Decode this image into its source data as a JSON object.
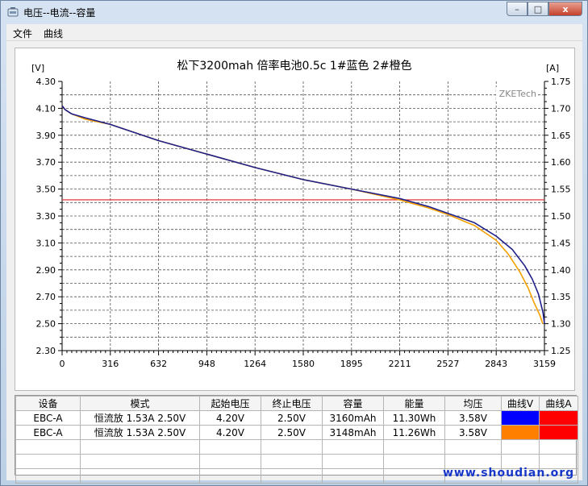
{
  "window": {
    "title": "电压--电流--容量",
    "icon": "battery-app-icon",
    "controls": {
      "minimize": "–",
      "maximize": "□",
      "close": "x"
    }
  },
  "menu": [
    {
      "label": "文件"
    },
    {
      "label": "曲线"
    }
  ],
  "colors": {
    "series1": "#1f1f8a",
    "series2": "#f5a000",
    "refline": "#e02020",
    "swatch_blue": "#0000ff",
    "swatch_orange": "#ff8000",
    "swatch_red": "#ff0000"
  },
  "chart_data": {
    "type": "line",
    "title": "松下3200mah 倍率电池0.5c 1#蓝色 2#橙色",
    "watermark": "ZKETech",
    "y_left_unit": "[V]",
    "y_right_unit": "[A]",
    "xlim": [
      0,
      3159
    ],
    "ylim": [
      2.3,
      4.3
    ],
    "y2lim": [
      1.25,
      1.75
    ],
    "x_ticks": [
      "0",
      "316",
      "632",
      "948",
      "1264",
      "1580",
      "1895",
      "2211",
      "2527",
      "2843",
      "3159"
    ],
    "y_ticks": [
      "2.30",
      "2.50",
      "2.70",
      "2.90",
      "3.10",
      "3.30",
      "3.50",
      "3.70",
      "3.90",
      "4.10",
      "4.30"
    ],
    "y2_ticks": [
      "1.25",
      "1.30",
      "1.35",
      "1.40",
      "1.45",
      "1.50",
      "1.55",
      "1.60",
      "1.65",
      "1.70",
      "1.75"
    ],
    "grid": true,
    "reference_line_y2": 1.53,
    "series": [
      {
        "x": [
          0,
          20,
          60,
          150,
          316,
          632,
          948,
          1264,
          1580,
          1895,
          2211,
          2400,
          2527,
          2700,
          2843,
          2950,
          3030,
          3080,
          3120,
          3150,
          3159
        ],
        "y": [
          4.12,
          4.09,
          4.06,
          4.03,
          3.98,
          3.86,
          3.76,
          3.66,
          3.57,
          3.5,
          3.43,
          3.37,
          3.32,
          3.25,
          3.15,
          3.05,
          2.93,
          2.83,
          2.72,
          2.58,
          2.5
        ]
      },
      {
        "x": [
          0,
          20,
          60,
          150,
          316,
          632,
          948,
          1264,
          1580,
          1895,
          2211,
          2400,
          2527,
          2700,
          2843,
          2920,
          3000,
          3050,
          3090,
          3130,
          3148
        ],
        "y": [
          4.12,
          4.09,
          4.06,
          4.02,
          3.98,
          3.86,
          3.76,
          3.66,
          3.57,
          3.5,
          3.42,
          3.36,
          3.31,
          3.23,
          3.12,
          3.02,
          2.88,
          2.77,
          2.66,
          2.56,
          2.5
        ]
      }
    ]
  },
  "table": {
    "headers": [
      "设备",
      "模式",
      "起始电压",
      "终止电压",
      "容量",
      "能量",
      "均压",
      "曲线V",
      "曲线A"
    ],
    "rows": [
      {
        "device": "EBC-A",
        "mode": "恒流放  1.53A  2.50V",
        "start_v": "4.20V",
        "end_v": "2.50V",
        "capacity": "3160mAh",
        "energy": "11.30Wh",
        "avg_v": "3.58V",
        "curve_v_color": "#0000ff",
        "curve_a_color": "#ff0000"
      },
      {
        "device": "EBC-A",
        "mode": "恒流放  1.53A  2.50V",
        "start_v": "4.20V",
        "end_v": "2.50V",
        "capacity": "3148mAh",
        "energy": "11.26Wh",
        "avg_v": "3.58V",
        "curve_v_color": "#ff8000",
        "curve_a_color": "#ff0000"
      }
    ],
    "empty_rows": 3
  },
  "watermark_site": "www.shoudian.org"
}
